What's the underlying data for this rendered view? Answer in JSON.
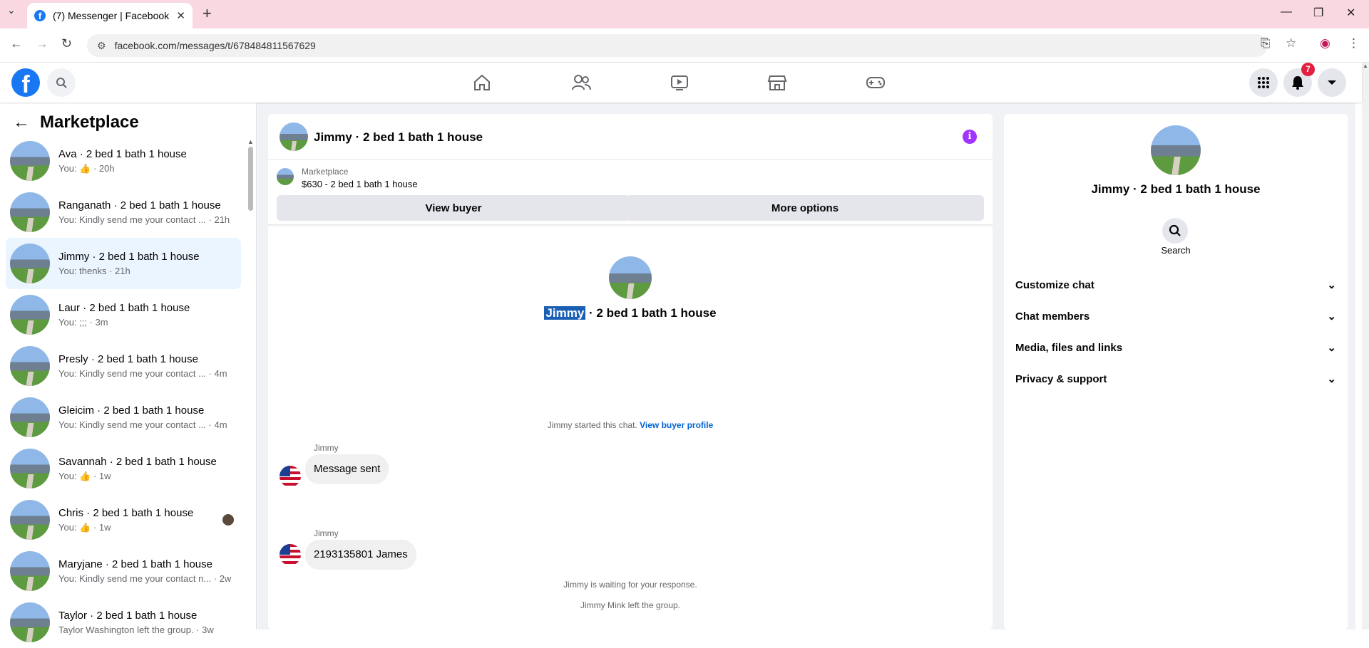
{
  "browser": {
    "tab_title": "(7) Messenger | Facebook",
    "url": "facebook.com/messages/t/678484811567629"
  },
  "header": {
    "notification_count": "7"
  },
  "sidebar": {
    "title": "Marketplace",
    "conversations": [
      {
        "name": "Ava · 2 bed 1 bath 1 house",
        "preview": "You: 👍 · 20h"
      },
      {
        "name": "Ranganath · 2 bed 1 bath 1 house",
        "preview": "You: Kindly send me your contact ... · 21h"
      },
      {
        "name": "Jimmy · 2 bed 1 bath 1 house",
        "preview": "You: thenks · 21h"
      },
      {
        "name": "Laur · 2 bed 1 bath 1 house",
        "preview": "You: ;;; · 3m"
      },
      {
        "name": "Presly · 2 bed 1 bath 1 house",
        "preview": "You: Kindly send me your contact ... · 4m"
      },
      {
        "name": "Gleicim · 2 bed 1 bath 1 house",
        "preview": "You: Kindly send me your contact ... · 4m"
      },
      {
        "name": "Savannah · 2 bed 1 bath 1 house",
        "preview": "You: 👍 · 1w"
      },
      {
        "name": "Chris · 2 bed 1 bath 1 house",
        "preview": "You: 👍 · 1w"
      },
      {
        "name": "Maryjane · 2 bed 1 bath 1 house",
        "preview": "You: Kindly send me your contact n... · 2w"
      },
      {
        "name": "Taylor · 2 bed 1 bath 1 house",
        "preview": "Taylor Washington left the group. · 3w"
      }
    ]
  },
  "chat": {
    "title": "Jimmy · 2 bed 1 bath 1 house",
    "listing_label": "Marketplace",
    "listing_price": "$630 - 2 bed 1 bath 1 house",
    "view_buyer": "View buyer",
    "more_options": "More options",
    "big_name_highlight": "Jimmy",
    "big_name_rest": " · 2 bed 1 bath 1 house",
    "started_text": "Jimmy started this chat.",
    "view_profile": "View buyer profile",
    "messages": [
      {
        "sender": "Jimmy",
        "text": "Message sent"
      },
      {
        "sender": "Jimmy",
        "text": "2193135801 James"
      }
    ],
    "waiting_text": "Jimmy is waiting for your response.",
    "left_text": "Jimmy Mink left the group."
  },
  "details": {
    "name": "Jimmy · 2 bed 1 bath 1 house",
    "search_label": "Search",
    "sections": [
      "Customize chat",
      "Chat members",
      "Media, files and links",
      "Privacy & support"
    ]
  }
}
